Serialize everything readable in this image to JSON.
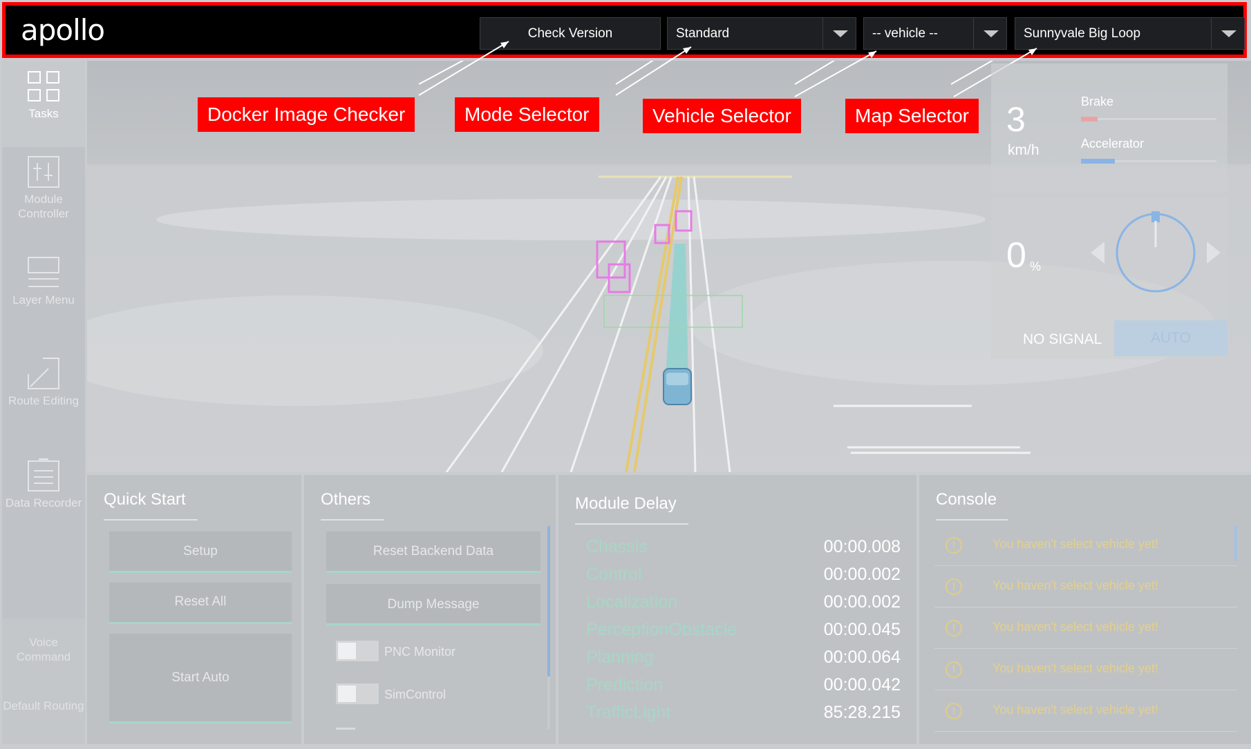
{
  "header": {
    "logo": "apollo",
    "check_version_label": "Check Version",
    "mode_value": "Standard",
    "vehicle_value": "-- vehicle --",
    "map_value": "Sunnyvale Big Loop"
  },
  "annotations": {
    "docker": "Docker Image Checker",
    "mode": "Mode Selector",
    "vehicle": "Vehicle Selector",
    "map": "Map Selector",
    "color": "#ff0000"
  },
  "sidebar": {
    "items": [
      {
        "label": "Tasks",
        "icon": "grid-icon"
      },
      {
        "label": "Module Controller",
        "icon": "sliders-icon"
      },
      {
        "label": "Layer Menu",
        "icon": "layers-icon"
      },
      {
        "label": "Route Editing",
        "icon": "route-edit-icon"
      },
      {
        "label": "Data Recorder",
        "icon": "document-icon"
      },
      {
        "label": "Voice Command"
      },
      {
        "label": "Default Routing"
      }
    ]
  },
  "dashboard": {
    "speed": "3",
    "speed_unit": "km/h",
    "brake_label": "Brake",
    "accelerator_label": "Accelerator",
    "brake_level": 0.12,
    "accelerator_level": 0.25,
    "steering_percent": "0",
    "steering_unit": "%",
    "signal": "NO SIGNAL",
    "mode_button": "AUTO",
    "brake_color": "#e8a4a4",
    "accelerator_color": "#8ab4e6"
  },
  "quick_start": {
    "title": "Quick Start",
    "buttons": [
      "Setup",
      "Reset All",
      "Start Auto"
    ]
  },
  "others": {
    "title": "Others",
    "buttons": [
      "Reset Backend Data",
      "Dump Message"
    ],
    "toggles": [
      "PNC Monitor",
      "SimControl"
    ]
  },
  "module_delay": {
    "title": "Module Delay",
    "rows": [
      {
        "name": "Chassis",
        "value": "00:00.008"
      },
      {
        "name": "Control",
        "value": "00:00.002"
      },
      {
        "name": "Localization",
        "value": "00:00.002"
      },
      {
        "name": "PerceptionObstacle",
        "value": "00:00.045"
      },
      {
        "name": "Planning",
        "value": "00:00.064"
      },
      {
        "name": "Prediction",
        "value": "00:00.042"
      },
      {
        "name": "TrafficLight",
        "value": "85:28.215"
      }
    ]
  },
  "console": {
    "title": "Console",
    "messages": [
      "You haven't select vehicle yet!",
      "You haven't select vehicle yet!",
      "You haven't select vehicle yet!",
      "You haven't select vehicle yet!",
      "You haven't select vehicle yet!"
    ]
  }
}
